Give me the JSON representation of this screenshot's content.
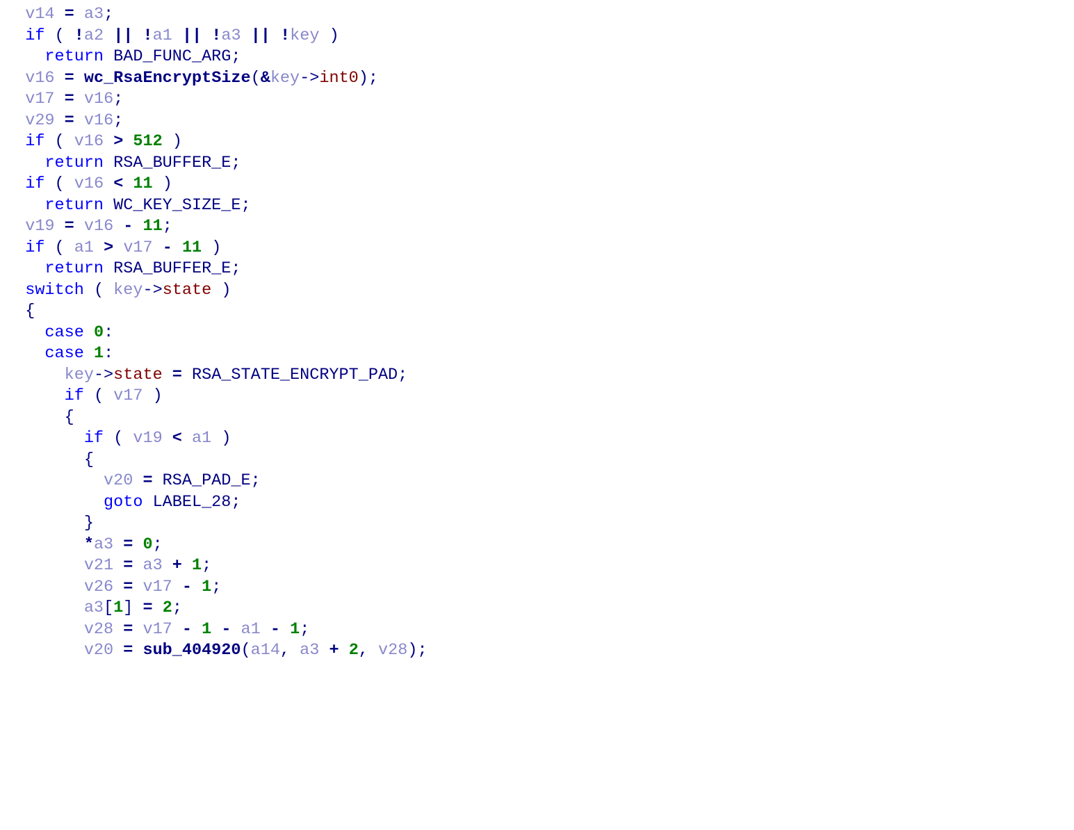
{
  "code": {
    "tokens": [
      [
        [
          "  ",
          "pun"
        ],
        [
          "v14",
          "var"
        ],
        [
          " ",
          "pun"
        ],
        [
          "=",
          "op"
        ],
        [
          " ",
          "pun"
        ],
        [
          "a3",
          "var"
        ],
        [
          ";",
          "pun"
        ]
      ],
      [
        [
          "  ",
          "pun"
        ],
        [
          "if",
          "kw"
        ],
        [
          " ",
          "pun"
        ],
        [
          "(",
          "pun"
        ],
        [
          " ",
          "pun"
        ],
        [
          "!",
          "op"
        ],
        [
          "a2",
          "var"
        ],
        [
          " ",
          "pun"
        ],
        [
          "||",
          "op"
        ],
        [
          " ",
          "pun"
        ],
        [
          "!",
          "op"
        ],
        [
          "a1",
          "var"
        ],
        [
          " ",
          "pun"
        ],
        [
          "||",
          "op"
        ],
        [
          " ",
          "pun"
        ],
        [
          "!",
          "op"
        ],
        [
          "a3",
          "var"
        ],
        [
          " ",
          "pun"
        ],
        [
          "||",
          "op"
        ],
        [
          " ",
          "pun"
        ],
        [
          "!",
          "op"
        ],
        [
          "key",
          "var"
        ],
        [
          " ",
          "pun"
        ],
        [
          ")",
          "pun"
        ]
      ],
      [
        [
          "    ",
          "pun"
        ],
        [
          "return",
          "kw"
        ],
        [
          " ",
          "pun"
        ],
        [
          "BAD_FUNC_ARG",
          "id"
        ],
        [
          ";",
          "pun"
        ]
      ],
      [
        [
          "  ",
          "pun"
        ],
        [
          "v16",
          "var"
        ],
        [
          " ",
          "pun"
        ],
        [
          "=",
          "op"
        ],
        [
          " ",
          "pun"
        ],
        [
          "wc_RsaEncryptSize",
          "fn"
        ],
        [
          "(",
          "pun"
        ],
        [
          "&",
          "op"
        ],
        [
          "key",
          "var"
        ],
        [
          "->",
          "pun"
        ],
        [
          "int0",
          "mem"
        ],
        [
          ")",
          "pun"
        ],
        [
          ";",
          "pun"
        ]
      ],
      [
        [
          "  ",
          "pun"
        ],
        [
          "v17",
          "var"
        ],
        [
          " ",
          "pun"
        ],
        [
          "=",
          "op"
        ],
        [
          " ",
          "pun"
        ],
        [
          "v16",
          "var"
        ],
        [
          ";",
          "pun"
        ]
      ],
      [
        [
          "  ",
          "pun"
        ],
        [
          "v29",
          "var"
        ],
        [
          " ",
          "pun"
        ],
        [
          "=",
          "op"
        ],
        [
          " ",
          "pun"
        ],
        [
          "v16",
          "var"
        ],
        [
          ";",
          "pun"
        ]
      ],
      [
        [
          "  ",
          "pun"
        ],
        [
          "if",
          "kw"
        ],
        [
          " ",
          "pun"
        ],
        [
          "(",
          "pun"
        ],
        [
          " ",
          "pun"
        ],
        [
          "v16",
          "var"
        ],
        [
          " ",
          "pun"
        ],
        [
          ">",
          "op"
        ],
        [
          " ",
          "pun"
        ],
        [
          "512",
          "num"
        ],
        [
          " ",
          "pun"
        ],
        [
          ")",
          "pun"
        ]
      ],
      [
        [
          "    ",
          "pun"
        ],
        [
          "return",
          "kw"
        ],
        [
          " ",
          "pun"
        ],
        [
          "RSA_BUFFER_E",
          "id"
        ],
        [
          ";",
          "pun"
        ]
      ],
      [
        [
          "  ",
          "pun"
        ],
        [
          "if",
          "kw"
        ],
        [
          " ",
          "pun"
        ],
        [
          "(",
          "pun"
        ],
        [
          " ",
          "pun"
        ],
        [
          "v16",
          "var"
        ],
        [
          " ",
          "pun"
        ],
        [
          "<",
          "op"
        ],
        [
          " ",
          "pun"
        ],
        [
          "11",
          "num"
        ],
        [
          " ",
          "pun"
        ],
        [
          ")",
          "pun"
        ]
      ],
      [
        [
          "    ",
          "pun"
        ],
        [
          "return",
          "kw"
        ],
        [
          " ",
          "pun"
        ],
        [
          "WC_KEY_SIZE_E",
          "id"
        ],
        [
          ";",
          "pun"
        ]
      ],
      [
        [
          "  ",
          "pun"
        ],
        [
          "v19",
          "var"
        ],
        [
          " ",
          "pun"
        ],
        [
          "=",
          "op"
        ],
        [
          " ",
          "pun"
        ],
        [
          "v16",
          "var"
        ],
        [
          " ",
          "pun"
        ],
        [
          "-",
          "op"
        ],
        [
          " ",
          "pun"
        ],
        [
          "11",
          "num"
        ],
        [
          ";",
          "pun"
        ]
      ],
      [
        [
          "  ",
          "pun"
        ],
        [
          "if",
          "kw"
        ],
        [
          " ",
          "pun"
        ],
        [
          "(",
          "pun"
        ],
        [
          " ",
          "pun"
        ],
        [
          "a1",
          "var"
        ],
        [
          " ",
          "pun"
        ],
        [
          ">",
          "op"
        ],
        [
          " ",
          "pun"
        ],
        [
          "v17",
          "var"
        ],
        [
          " ",
          "pun"
        ],
        [
          "-",
          "op"
        ],
        [
          " ",
          "pun"
        ],
        [
          "11",
          "num"
        ],
        [
          " ",
          "pun"
        ],
        [
          ")",
          "pun"
        ]
      ],
      [
        [
          "    ",
          "pun"
        ],
        [
          "return",
          "kw"
        ],
        [
          " ",
          "pun"
        ],
        [
          "RSA_BUFFER_E",
          "id"
        ],
        [
          ";",
          "pun"
        ]
      ],
      [
        [
          "  ",
          "pun"
        ],
        [
          "switch",
          "kw"
        ],
        [
          " ",
          "pun"
        ],
        [
          "(",
          "pun"
        ],
        [
          " ",
          "pun"
        ],
        [
          "key",
          "var"
        ],
        [
          "->",
          "pun"
        ],
        [
          "state",
          "mem"
        ],
        [
          " ",
          "pun"
        ],
        [
          ")",
          "pun"
        ]
      ],
      [
        [
          "  ",
          "pun"
        ],
        [
          "{",
          "pun"
        ]
      ],
      [
        [
          "    ",
          "pun"
        ],
        [
          "case",
          "kw"
        ],
        [
          " ",
          "pun"
        ],
        [
          "0",
          "num"
        ],
        [
          ":",
          "pun"
        ]
      ],
      [
        [
          "    ",
          "pun"
        ],
        [
          "case",
          "kw"
        ],
        [
          " ",
          "pun"
        ],
        [
          "1",
          "num"
        ],
        [
          ":",
          "pun"
        ]
      ],
      [
        [
          "      ",
          "pun"
        ],
        [
          "key",
          "var"
        ],
        [
          "->",
          "pun"
        ],
        [
          "state",
          "mem"
        ],
        [
          " ",
          "pun"
        ],
        [
          "=",
          "op"
        ],
        [
          " ",
          "pun"
        ],
        [
          "RSA_STATE_ENCRYPT_PAD",
          "id"
        ],
        [
          ";",
          "pun"
        ]
      ],
      [
        [
          "      ",
          "pun"
        ],
        [
          "if",
          "kw"
        ],
        [
          " ",
          "pun"
        ],
        [
          "(",
          "pun"
        ],
        [
          " ",
          "pun"
        ],
        [
          "v17",
          "var"
        ],
        [
          " ",
          "pun"
        ],
        [
          ")",
          "pun"
        ]
      ],
      [
        [
          "      ",
          "pun"
        ],
        [
          "{",
          "pun"
        ]
      ],
      [
        [
          "        ",
          "pun"
        ],
        [
          "if",
          "kw"
        ],
        [
          " ",
          "pun"
        ],
        [
          "(",
          "pun"
        ],
        [
          " ",
          "pun"
        ],
        [
          "v19",
          "var"
        ],
        [
          " ",
          "pun"
        ],
        [
          "<",
          "op"
        ],
        [
          " ",
          "pun"
        ],
        [
          "a1",
          "var"
        ],
        [
          " ",
          "pun"
        ],
        [
          ")",
          "pun"
        ]
      ],
      [
        [
          "        ",
          "pun"
        ],
        [
          "{",
          "pun"
        ]
      ],
      [
        [
          "          ",
          "pun"
        ],
        [
          "v20",
          "var"
        ],
        [
          " ",
          "pun"
        ],
        [
          "=",
          "op"
        ],
        [
          " ",
          "pun"
        ],
        [
          "RSA_PAD_E",
          "id"
        ],
        [
          ";",
          "pun"
        ]
      ],
      [
        [
          "          ",
          "pun"
        ],
        [
          "goto",
          "kw"
        ],
        [
          " ",
          "pun"
        ],
        [
          "LABEL_28",
          "id"
        ],
        [
          ";",
          "pun"
        ]
      ],
      [
        [
          "        ",
          "pun"
        ],
        [
          "}",
          "pun"
        ]
      ],
      [
        [
          "        ",
          "pun"
        ],
        [
          "*",
          "op"
        ],
        [
          "a3",
          "var"
        ],
        [
          " ",
          "pun"
        ],
        [
          "=",
          "op"
        ],
        [
          " ",
          "pun"
        ],
        [
          "0",
          "num"
        ],
        [
          ";",
          "pun"
        ]
      ],
      [
        [
          "        ",
          "pun"
        ],
        [
          "v21",
          "var"
        ],
        [
          " ",
          "pun"
        ],
        [
          "=",
          "op"
        ],
        [
          " ",
          "pun"
        ],
        [
          "a3",
          "var"
        ],
        [
          " ",
          "pun"
        ],
        [
          "+",
          "op"
        ],
        [
          " ",
          "pun"
        ],
        [
          "1",
          "num"
        ],
        [
          ";",
          "pun"
        ]
      ],
      [
        [
          "        ",
          "pun"
        ],
        [
          "v26",
          "var"
        ],
        [
          " ",
          "pun"
        ],
        [
          "=",
          "op"
        ],
        [
          " ",
          "pun"
        ],
        [
          "v17",
          "var"
        ],
        [
          " ",
          "pun"
        ],
        [
          "-",
          "op"
        ],
        [
          " ",
          "pun"
        ],
        [
          "1",
          "num"
        ],
        [
          ";",
          "pun"
        ]
      ],
      [
        [
          "        ",
          "pun"
        ],
        [
          "a3",
          "var"
        ],
        [
          "[",
          "pun"
        ],
        [
          "1",
          "num"
        ],
        [
          "]",
          "pun"
        ],
        [
          " ",
          "pun"
        ],
        [
          "=",
          "op"
        ],
        [
          " ",
          "pun"
        ],
        [
          "2",
          "num"
        ],
        [
          ";",
          "pun"
        ]
      ],
      [
        [
          "        ",
          "pun"
        ],
        [
          "v28",
          "var"
        ],
        [
          " ",
          "pun"
        ],
        [
          "=",
          "op"
        ],
        [
          " ",
          "pun"
        ],
        [
          "v17",
          "var"
        ],
        [
          " ",
          "pun"
        ],
        [
          "-",
          "op"
        ],
        [
          " ",
          "pun"
        ],
        [
          "1",
          "num"
        ],
        [
          " ",
          "pun"
        ],
        [
          "-",
          "op"
        ],
        [
          " ",
          "pun"
        ],
        [
          "a1",
          "var"
        ],
        [
          " ",
          "pun"
        ],
        [
          "-",
          "op"
        ],
        [
          " ",
          "pun"
        ],
        [
          "1",
          "num"
        ],
        [
          ";",
          "pun"
        ]
      ],
      [
        [
          "        ",
          "pun"
        ],
        [
          "v20",
          "var"
        ],
        [
          " ",
          "pun"
        ],
        [
          "=",
          "op"
        ],
        [
          " ",
          "pun"
        ],
        [
          "sub_404920",
          "fn"
        ],
        [
          "(",
          "pun"
        ],
        [
          "a14",
          "var"
        ],
        [
          ",",
          "pun"
        ],
        [
          " ",
          "pun"
        ],
        [
          "a3",
          "var"
        ],
        [
          " ",
          "pun"
        ],
        [
          "+",
          "op"
        ],
        [
          " ",
          "pun"
        ],
        [
          "2",
          "num"
        ],
        [
          ",",
          "pun"
        ],
        [
          " ",
          "pun"
        ],
        [
          "v28",
          "var"
        ],
        [
          ")",
          "pun"
        ],
        [
          ";",
          "pun"
        ]
      ]
    ]
  }
}
